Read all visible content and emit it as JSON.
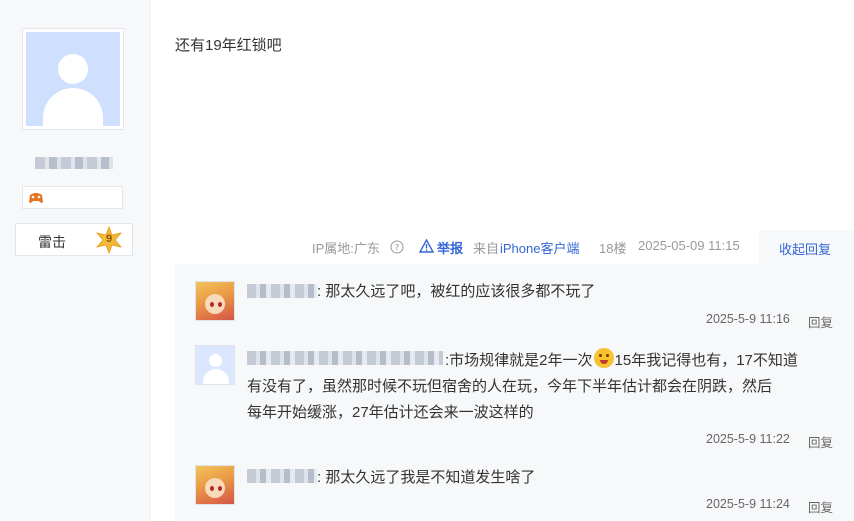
{
  "user": {
    "level_name": "雷击",
    "level_number": "9",
    "avatar_icon": "default-avatar-icon",
    "badge_icon": "game-controller-icon"
  },
  "post": {
    "content": "还有19年红锁吧",
    "ip_location": "IP属地:广东",
    "report_label": "举报",
    "client_prefix": "来自",
    "client_name": "iPhone客户端",
    "floor": "18楼",
    "datetime": "2025-05-09 11:15",
    "collapse_label": "收起回复"
  },
  "replies": [
    {
      "text": ": 那太久远了吧，被红的应该很多都不玩了",
      "time": "2025-5-9 11:16",
      "reply_label": "回复"
    },
    {
      "text_before_emoji": ":市场规律就是2年一次",
      "text_after_emoji": "15年我记得也有，17不知道",
      "line2": "有没有了，虽然那时候不玩但宿舍的人在玩，今年下半年估计都会在阴跌，然后",
      "line3": "每年开始缓涨，27年估计还会来一波这样的",
      "time": "2025-5-9 11:22",
      "reply_label": "回复"
    },
    {
      "text": ": 那太久远了我是不知道发生啥了",
      "time": "2025-5-9 11:24",
      "reply_label": "回复"
    }
  ],
  "colors": {
    "link": "#3467d6",
    "panel_bg": "#f7f8fa"
  }
}
